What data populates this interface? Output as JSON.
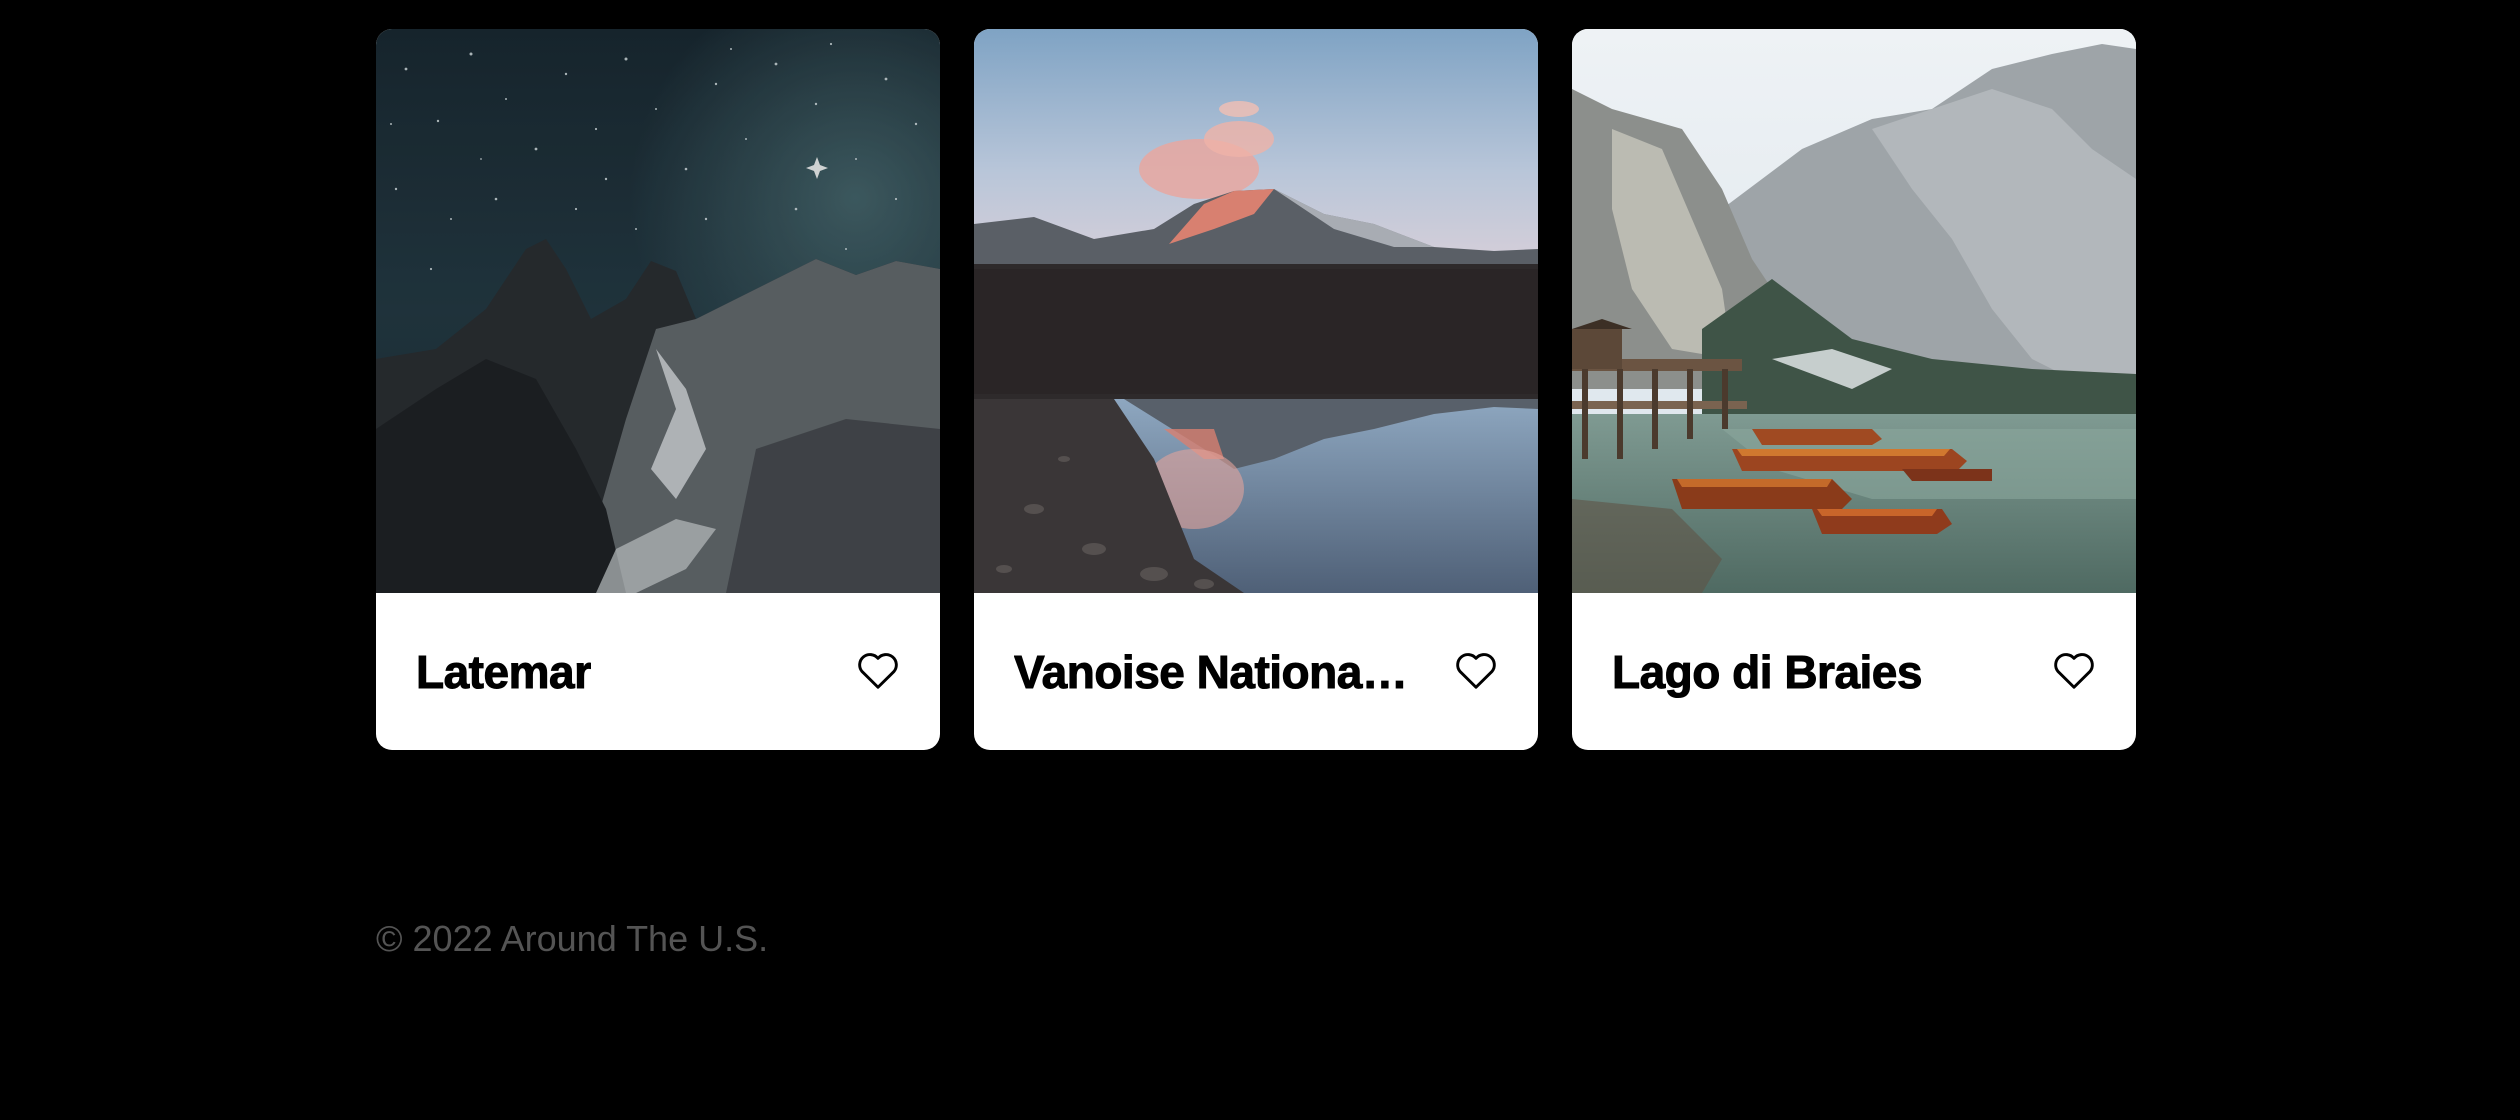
{
  "cards": [
    {
      "title": "Latemar",
      "image": "starry-night-mountain-peaks"
    },
    {
      "title": "Vanoise Nationa…",
      "image": "mountain-lake-reflection-sunset"
    },
    {
      "title": "Lago di Braies",
      "image": "alpine-lake-with-boats-and-pier"
    }
  ],
  "like_icon": "heart-outline-icon",
  "footer": {
    "copyright": "© 2022 Around The U.S."
  },
  "colors": {
    "background": "#000000",
    "card": "#ffffff",
    "footer_text": "#545454"
  }
}
